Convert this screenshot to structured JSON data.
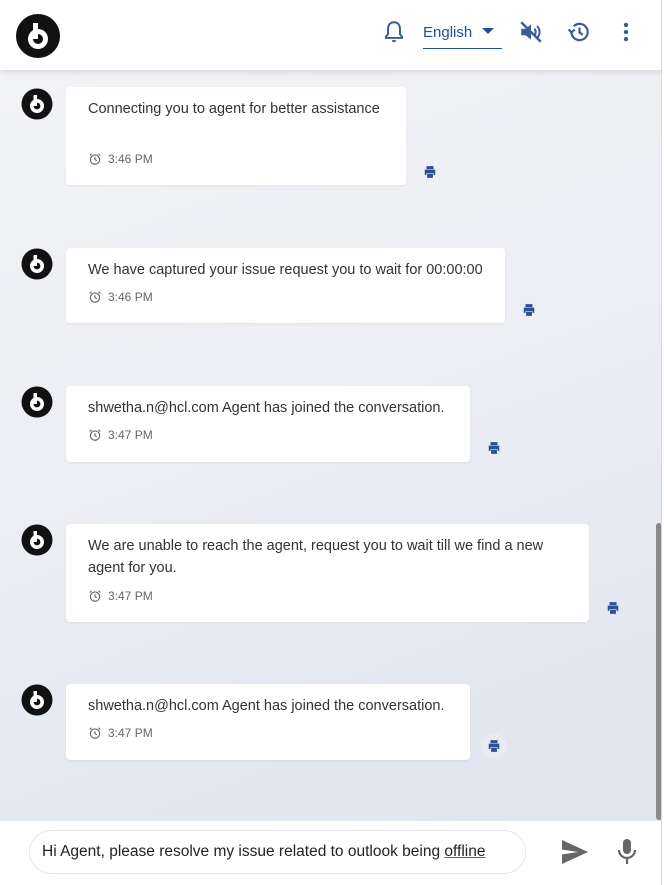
{
  "header": {
    "language": "English",
    "icons": [
      "bell-icon",
      "mute-icon",
      "history-icon",
      "more-vert-icon"
    ]
  },
  "messages": [
    {
      "text": "Connecting you to agent for better assistance",
      "time": "3:46 PM"
    },
    {
      "text": "We have captured your issue request you to wait for 00:00:00",
      "time": "3:46 PM"
    },
    {
      "text": "shwetha.n@hcl.com Agent has joined the conversation.",
      "time": "3:47 PM"
    },
    {
      "text": "We are unable to reach the agent, request you to wait till we find a new agent for you.",
      "time": "3:47 PM"
    },
    {
      "text": "shwetha.n@hcl.com Agent has joined the conversation.",
      "time": "3:47 PM"
    }
  ],
  "composer": {
    "text_main": "Hi Agent, please resolve my issue related to outlook being ",
    "text_flagged": "offline"
  },
  "colors": {
    "accent": "#1f4f9a",
    "icon": "#3a5a98"
  }
}
